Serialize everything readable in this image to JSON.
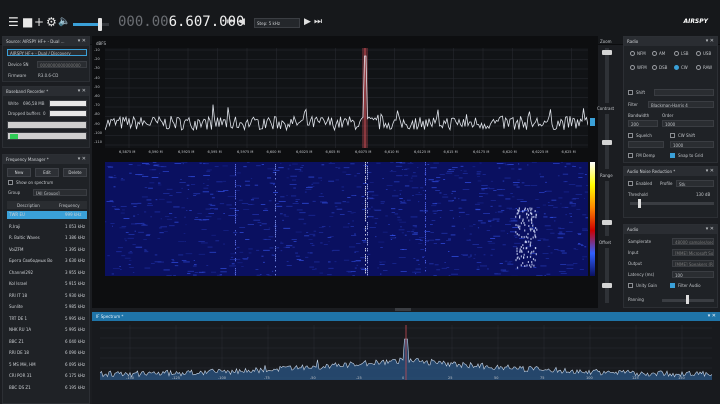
{
  "toolbar": {
    "menu_icon": "☰",
    "stop_icon": "■",
    "add_icon": "+",
    "settings_icon": "⚙",
    "volume_icon": "🔈",
    "volume_level": 0.7,
    "frequency_dim": "000.00",
    "frequency_main": "6.607.000",
    "tune_prev_fast": "⏮",
    "tune_prev": "◀",
    "tune_next": "▶",
    "tune_next_fast": "⏭",
    "step": "Step: 5 kHz",
    "brand": "AIRSPY"
  },
  "source": {
    "title": "Source: AIRSPY HF+ - Dual ...",
    "device_select": "AIRSPY HF+ - Dual / Discovery",
    "device_sn_label": "Device SN",
    "device_sn_value": "0000000000000000",
    "firmware_label": "Firmware",
    "firmware_value": "R3.0.6-CD"
  },
  "baseband": {
    "title": "Baseband Recorder *",
    "write_label": "Write",
    "write_value": "696,58 MB",
    "dropped_label": "Dropped buffers",
    "dropped_value": "0"
  },
  "freqmgr": {
    "title": "Frequency Manager *",
    "new": "New",
    "edit": "Edit",
    "delete": "Delete",
    "show_on_spectrum": "Show on spectrum",
    "group_label": "Group",
    "group_value": "[All Groups]",
    "col_desc": "Description",
    "col_freq": "Frequency",
    "rows": [
      {
        "desc": "TWR EU",
        "freq": "999 kHz"
      },
      {
        "desc": "R.Iraji",
        "freq": "1 053 kHz"
      },
      {
        "desc": "R. Baltic Waves",
        "freq": "1 386 kHz"
      },
      {
        "desc": "VoiZFM",
        "freq": "1 395 kHz"
      },
      {
        "desc": "Брега Свободных Во",
        "freq": "3 630 kHz"
      },
      {
        "desc": "Channel292",
        "freq": "3 955 kHz"
      },
      {
        "desc": "Kol Israel",
        "freq": "5 915 kHz"
      },
      {
        "desc": "RRI IT 18",
        "freq": "5 930 kHz"
      },
      {
        "desc": "Sunlite",
        "freq": "5 985 kHz"
      },
      {
        "desc": "TRT DE 1",
        "freq": "5 995 kHz"
      },
      {
        "desc": "NHK RU 1A",
        "freq": "5 995 kHz"
      },
      {
        "desc": "BBC Z1",
        "freq": "6 040 kHz"
      },
      {
        "desc": "RRI DE 18",
        "freq": "6 090 kHz"
      },
      {
        "desc": "5 MS MH, HM",
        "freq": "6 095 kHz"
      },
      {
        "desc": "CRI POR 31",
        "freq": "6 175 kHz"
      },
      {
        "desc": "BBC DS Z1",
        "freq": "6 195 kHz"
      }
    ]
  },
  "spectrum": {
    "unit": "dBFS",
    "y_ticks": [
      "-10",
      "-20",
      "-30",
      "-40",
      "-50",
      "-60",
      "-70",
      "-80",
      "-90",
      "-100",
      "-110"
    ],
    "x_ticks": [
      "6,5875 M",
      "6,590 M",
      "6,5925 M",
      "6,595 M",
      "6,5975 M",
      "6,600 M",
      "6,6025 M",
      "6,605 M",
      "6,6075 M",
      "6,610 M",
      "6,6125 M",
      "6,615 M",
      "6,6175 M",
      "6,620 M",
      "6,6225 M",
      "6,625 M"
    ]
  },
  "side_sliders": {
    "zoom": "Zoom",
    "contrast": "Contrast",
    "range": "Range",
    "offset": "Offset"
  },
  "radio": {
    "title": "Radio",
    "modes": [
      "NFM",
      "AM",
      "LSB",
      "USB",
      "WFM",
      "DSB",
      "CW",
      "RAW"
    ],
    "selected_mode": "CW",
    "shift_label": "Shift",
    "filter_label": "Filter",
    "filter_value": "Blackman-Harris 4",
    "bandwidth_label": "Bandwidth",
    "order_label": "Order",
    "bandwidth_value": "200",
    "order_value": "1000",
    "squelch_label": "Squelch",
    "cw_shift_label": "CW Shift",
    "cw_shift_value": "1000",
    "fm_demp_label": "FM Demp",
    "snap_label": "Snap to Grid"
  },
  "anr": {
    "title": "Audio Noise Reduction *",
    "enabled": "Enabled",
    "profile_label": "Profile",
    "profile_value": "Stk",
    "threshold_label": "Threshold",
    "threshold_value": "130 dB"
  },
  "audio": {
    "title": "Audio",
    "samplerate_label": "Samplerate",
    "samplerate_value": "48000 samples/sec",
    "input_label": "Input",
    "input_value": "[MME] Microsoft Sound",
    "output_label": "Output",
    "output_value": "[MME] Speakers (Re",
    "latency_label": "Latency (ms)",
    "latency_value": "100",
    "unity_gain": "Unity Gain",
    "filter_audio": "Filter Audio",
    "panning_label": "Panning"
  },
  "if_spectrum": {
    "title": "IF Spectrum *",
    "x_ticks": [
      "-150",
      "-125",
      "-100",
      "-75",
      "-50",
      "-25",
      "0",
      "25",
      "50",
      "75",
      "100",
      "125",
      "150"
    ]
  },
  "colors": {
    "accent": "#3aa0d8",
    "waterfall_bg": "#0a1060",
    "trace": "#dfe3ea",
    "tuning_marker": "#c64a52"
  }
}
